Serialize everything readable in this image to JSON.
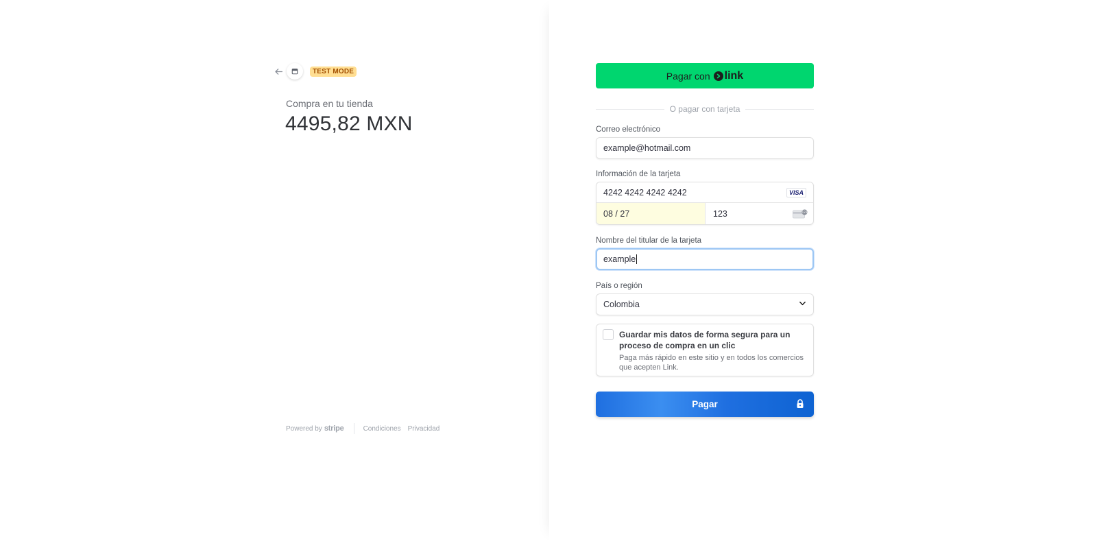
{
  "header": {
    "test_mode_badge": "TEST MODE",
    "back_icon": "arrow-left-icon",
    "store_icon": "store-icon"
  },
  "summary": {
    "merchant_name": "Compra en tu tienda",
    "amount": "4495,82 MXN"
  },
  "footer": {
    "powered_by": "Powered by",
    "stripe": "stripe",
    "terms": "Condiciones",
    "privacy": "Privacidad"
  },
  "form": {
    "link_button_prefix": "Pagar con",
    "link_brand": "link",
    "divider_text": "O pagar con tarjeta",
    "email_label": "Correo electrónico",
    "email_value": "example@hotmail.com",
    "card_label": "Información de la tarjeta",
    "card_number": "4242 4242 4242 4242",
    "card_brand": "VISA",
    "expiry": "08 / 27",
    "cvc": "123",
    "name_label": "Nombre del titular de la tarjeta",
    "name_value": "example",
    "country_label": "País o región",
    "country_value": "Colombia",
    "save_title": "Guardar mis datos de forma segura para un proceso de compra en un clic",
    "save_desc": "Paga más rápido en este sitio y en todos los comercios que acepten Link.",
    "save_checked": false,
    "pay_button": "Pagar"
  },
  "colors": {
    "link_green": "#00d66f",
    "pay_blue": "#1f6fe0",
    "test_badge_bg": "#ffde92",
    "test_badge_text": "#a24e00",
    "expiry_autofill_bg": "#fefde0",
    "focus_border": "#9dc7f4"
  }
}
